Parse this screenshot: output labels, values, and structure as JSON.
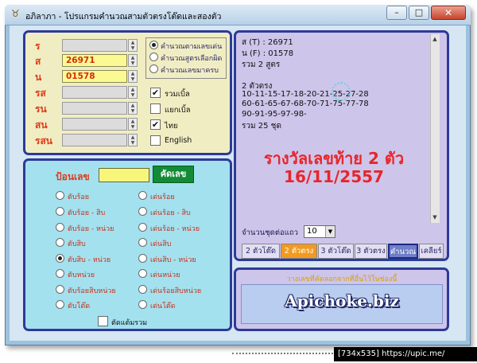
{
  "window": {
    "title": "อภิลาภา - โปรแกรมคำนวณสามตัวตรงโต๊ดและสองตัว",
    "minimize": "–",
    "maximize": "□",
    "close": "✕"
  },
  "fields": [
    {
      "label": "ร",
      "value": ""
    },
    {
      "label": "ส",
      "value": "26971"
    },
    {
      "label": "น",
      "value": "01578"
    },
    {
      "label": "รส",
      "value": ""
    },
    {
      "label": "รน",
      "value": ""
    },
    {
      "label": "สน",
      "value": ""
    },
    {
      "label": "รสน",
      "value": ""
    }
  ],
  "calc_modes": [
    {
      "label": "คำนวณตามเลขเด่น",
      "selected": true
    },
    {
      "label": "คำนวณสูตรเลือกผิด",
      "selected": false
    },
    {
      "label": "คำนวณเลขมาครบ",
      "selected": false
    }
  ],
  "checkboxes": [
    {
      "label": "รวมเบิ้ล",
      "checked": true
    },
    {
      "label": "แยกเบิ้ล",
      "checked": false
    },
    {
      "label": "ไทย",
      "checked": true
    },
    {
      "label": "English",
      "checked": false
    }
  ],
  "input_panel": {
    "label": "ป้อนเลข",
    "value": "",
    "button": "คัดเลข"
  },
  "positions_left": [
    {
      "label": "ตับร้อย",
      "selected": false
    },
    {
      "label": "ตับร้อย - สิบ",
      "selected": false
    },
    {
      "label": "ตับร้อย - หน่วย",
      "selected": false
    },
    {
      "label": "ตับสิบ",
      "selected": false
    },
    {
      "label": "ตับสิบ - หน่วย",
      "selected": true
    },
    {
      "label": "ตับหน่วย",
      "selected": false
    },
    {
      "label": "ตับร้อยสิบหน่วย",
      "selected": false
    },
    {
      "label": "ตับโต๊ด",
      "selected": false
    }
  ],
  "positions_right": [
    {
      "label": "เด่นร้อย",
      "selected": false
    },
    {
      "label": "เด่นร้อย - สิบ",
      "selected": false
    },
    {
      "label": "เด่นร้อย - หน่วย",
      "selected": false
    },
    {
      "label": "เด่นสิบ",
      "selected": false
    },
    {
      "label": "เด่นสิบ - หน่วย",
      "selected": false
    },
    {
      "label": "เด่นหน่วย",
      "selected": false
    },
    {
      "label": "เด่นร้อยสิบหน่วย",
      "selected": false
    },
    {
      "label": "เด่นโต๊ด",
      "selected": false
    }
  ],
  "cut_remainder": {
    "label": "ตัดแต้มรวม",
    "checked": false
  },
  "results": {
    "lines": [
      "ส (T) : 26971",
      "น (F) : 01578",
      "รวม 2 สูตร",
      "",
      "2 ตัวตรง",
      "10-11-15-17-18-20-21-25-27-28",
      "60-61-65-67-68-70-71-75-77-78",
      "90-91-95-97-98-",
      "รวม 25 ชุด"
    ],
    "overlay_line1": "รางวัลเลขท้าย 2 ตัว",
    "overlay_line2": "16/11/2557"
  },
  "rows_per_line": {
    "label": "จำนวนชุดต่อแถว",
    "value": "10"
  },
  "tabs": [
    {
      "label": "2 ตัวโต๊ด",
      "style": "normal"
    },
    {
      "label": "2 ตัวตรง",
      "style": "orange"
    },
    {
      "label": "3 ตัวโต๊ด",
      "style": "normal"
    },
    {
      "label": "3 ตัวตรง",
      "style": "normal"
    },
    {
      "label": "คำนวณ",
      "style": "blue"
    },
    {
      "label": "เคลียร์",
      "style": "normal"
    }
  ],
  "paste_box": {
    "title": "วางเลขที่คัดลอกจากที่อื่นไว้ในช่องนี้",
    "watermark": "Apichoke.biz"
  },
  "footer": {
    "size": "[734x535]",
    "site": "https://upic.me/"
  }
}
